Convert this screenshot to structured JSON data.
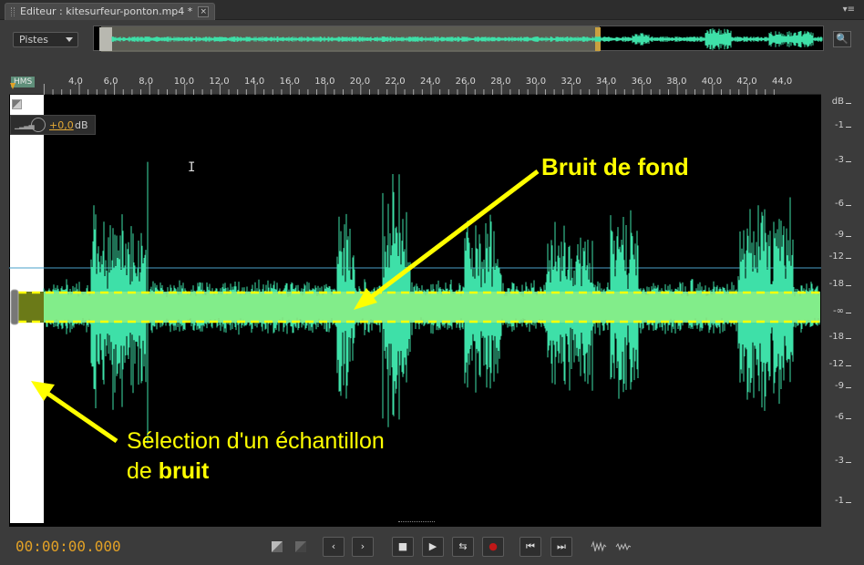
{
  "tab": {
    "title": "Editeur : kitesurfeur-ponton.mp4 *",
    "close": "×"
  },
  "panel_menu": "▾≡",
  "tracks_select": {
    "value": "Pistes"
  },
  "ruler": {
    "hms": "HMS",
    "ticks": [
      "4,0",
      "6,0",
      "8,0",
      "10,0",
      "12,0",
      "14,0",
      "16,0",
      "18,0",
      "20,0",
      "22,0",
      "24,0",
      "26,0",
      "28,0",
      "30,0",
      "32,0",
      "34,0",
      "36,0",
      "38,0",
      "40,0",
      "42,0",
      "44,0"
    ]
  },
  "volume": {
    "value": "+0,0",
    "unit": "dB"
  },
  "db_scale": {
    "labels": [
      "dB",
      "-1",
      "-3",
      "-6",
      "-9",
      "-12",
      "-18",
      "-∞",
      "-18",
      "-12",
      "-9",
      "-6",
      "-3",
      "-1"
    ]
  },
  "annotations": {
    "noise": "Bruit de fond",
    "selection_line1": "Sélection d'un échantillon",
    "selection_line2_prefix": "de ",
    "selection_line2_bold": "bruit"
  },
  "transport": {
    "timecode": "00:00:00.000"
  },
  "colors": {
    "waveform": "#3ee0a8",
    "highlight": "#88ee88",
    "annotation": "#ffff00",
    "timecode": "#e2a126"
  }
}
